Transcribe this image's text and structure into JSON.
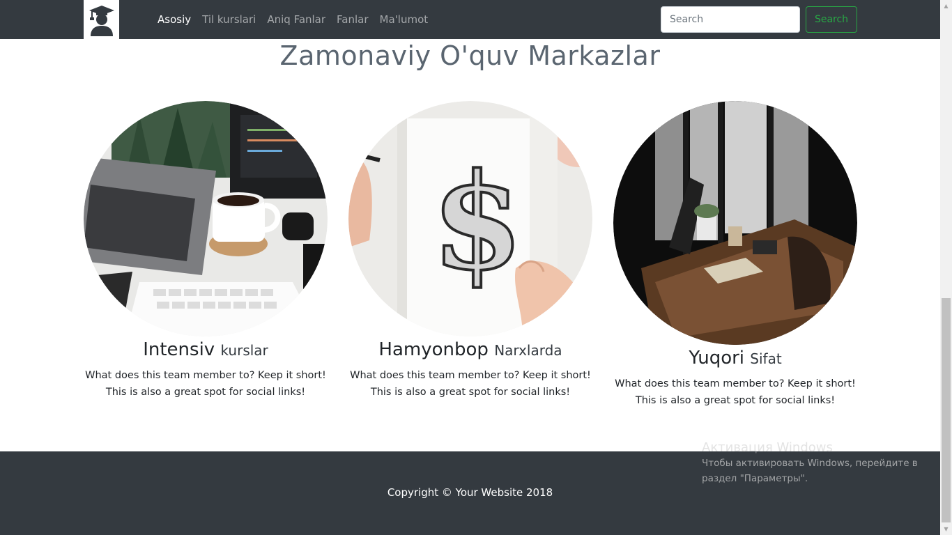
{
  "nav": {
    "brand_icon": "graduate-student-icon",
    "links": [
      {
        "label": "Asosiy",
        "active": true
      },
      {
        "label": "Til kurslari",
        "active": false
      },
      {
        "label": "Aniq Fanlar",
        "active": false
      },
      {
        "label": "Fanlar",
        "active": false
      },
      {
        "label": "Ma'lumot",
        "active": false
      }
    ],
    "search_placeholder": "Search",
    "search_button": "Search"
  },
  "main": {
    "title": "Zamonaviy O'quv Markazlar",
    "cards": [
      {
        "title": "Intensiv",
        "subtitle": "kurslar",
        "text": "What does this team member to? Keep it short! This is also a great spot for social links!",
        "image": "laptop-coffee-desk-photo"
      },
      {
        "title": "Hamyonbop",
        "subtitle": "Narxlarda",
        "text": "What does this team member to? Keep it short! This is also a great spot for social links!",
        "image": "dollar-sign-notebook-photo"
      },
      {
        "title": "Yuqori",
        "subtitle": "Sifat",
        "text": "What does this team member to? Keep it short! This is also a great spot for social links!",
        "image": "cafe-workspace-photo"
      }
    ]
  },
  "footer": {
    "copyright": "Copyright © Your Website 2018"
  },
  "os_overlay": {
    "title": "Активация Windows",
    "line1": "Чтобы активировать Windows, перейдите в",
    "line2": "раздел \"Параметры\"."
  },
  "colors": {
    "navbar": "#343a40",
    "accent_success": "#28a745",
    "title": "#5a6570"
  }
}
